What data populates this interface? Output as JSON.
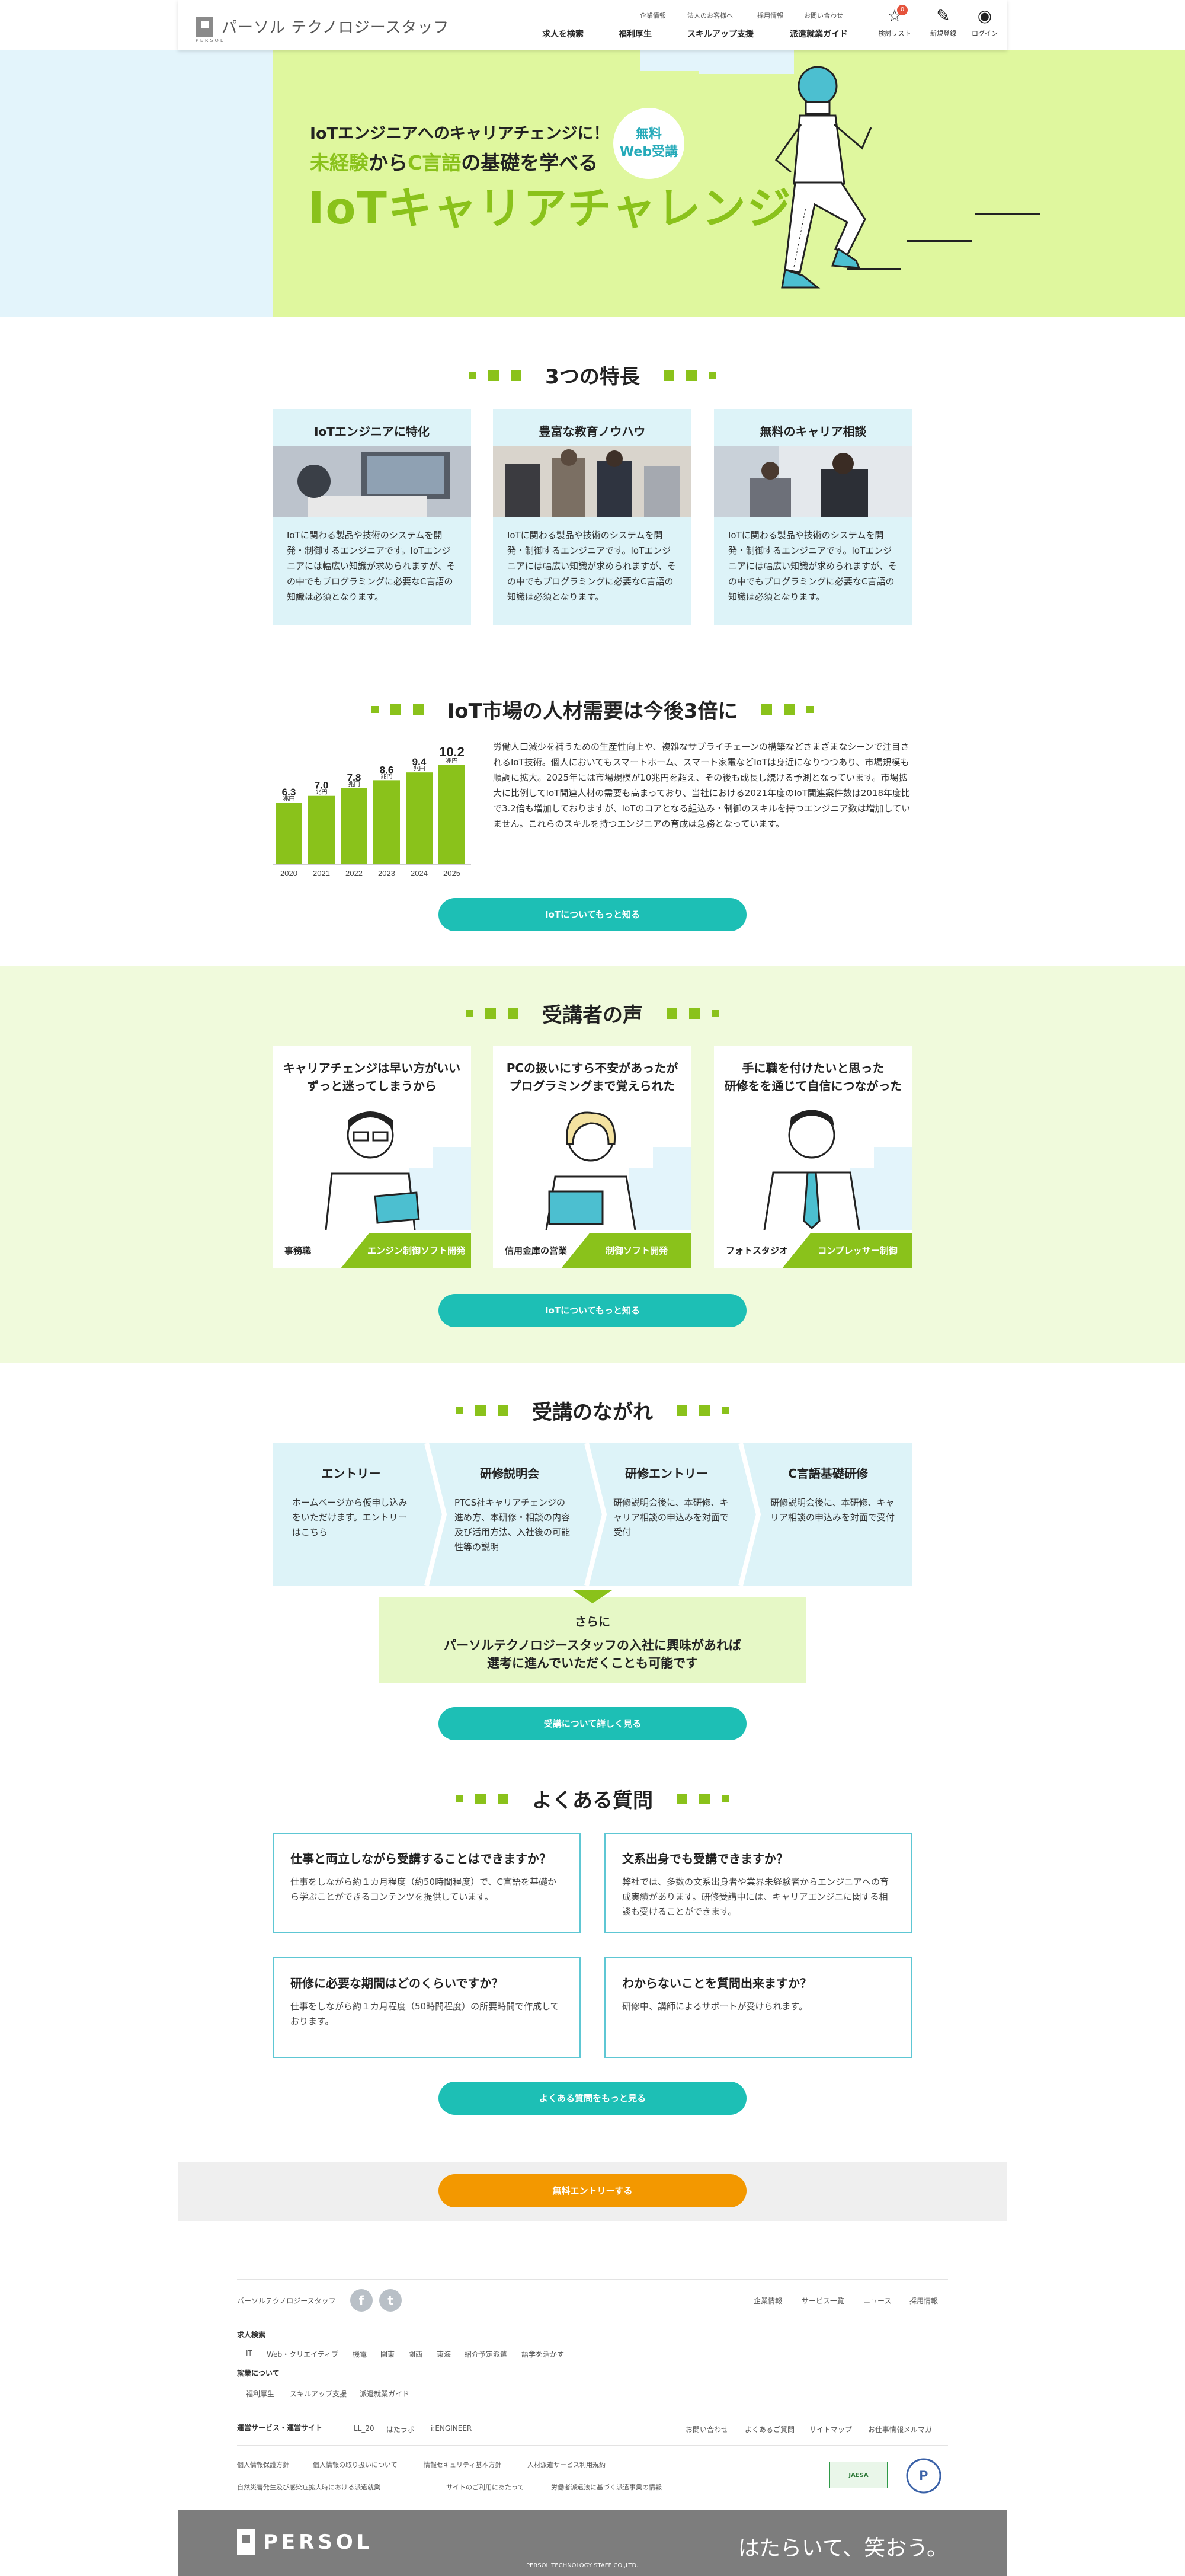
{
  "header": {
    "brand": "パーソル テクノロジースタッフ",
    "brand_sub": "PERSOL",
    "utility": [
      "企業情報",
      "法人のお客様へ",
      "採用情報",
      "お問い合わせ"
    ],
    "nav": [
      "求人を検索",
      "福利厚生",
      "スキルアップ支援",
      "派遣就業ガイド"
    ],
    "icons": [
      {
        "label": "検討リスト",
        "icon": "star-icon",
        "badge": "0"
      },
      {
        "label": "新規登録",
        "icon": "edit-icon"
      },
      {
        "label": "ログイン",
        "icon": "user-icon"
      }
    ]
  },
  "hero": {
    "pre": "IoTエンジニアへのキャリアチェンジに！",
    "sub_a": "未経験",
    "sub_b": "から",
    "sub_c": "C言語",
    "sub_d": "の基礎を学べる",
    "title": "IoTキャリアチャレンジ",
    "badge_1": "無料",
    "badge_2": "Web受講"
  },
  "features": {
    "heading": "3つの特長",
    "items": [
      {
        "title": "IoTエンジニアに特化",
        "text": "IoTに関わる製品や技術のシステムを開発・制御するエンジニアです。IoTエンジニアには幅広い知識が求められますが、その中でもプログラミングに必要なC言語の知識は必須となります。"
      },
      {
        "title": "豊富な教育ノウハウ",
        "text": "IoTに関わる製品や技術のシステムを開発・制御するエンジニアです。IoTエンジニアには幅広い知識が求められますが、その中でもプログラミングに必要なC言語の知識は必須となります。"
      },
      {
        "title": "無料のキャリア相談",
        "text": "IoTに関わる製品や技術のシステムを開発・制御するエンジニアです。IoTエンジニアには幅広い知識が求められますが、その中でもプログラミングに必要なC言語の知識は必須となります。"
      }
    ]
  },
  "market": {
    "heading": "IoT市場の人材需要は今後3倍に",
    "text": "労働人口減少を補うための生産性向上や、複雑なサプライチェーンの構築などさまざまなシーンで注目されるIoT技術。個人においてもスマートホーム、スマート家電などIoTは身近になりつつあり、市場規模も順調に拡大。2025年には市場規模が10兆円を超え、その後も成長し続ける予測となっています。市場拡大に比例してIoT関連人材の需要も高まっており、当社における2021年度のIoT関連案件数は2018年度比で3.2倍も増加しておりますが、IoTのコアとなる組込み・制御のスキルを持つエンジニア数は増加していません。これらのスキルを持つエンジニアの育成は急務となっています。",
    "button": "IoTについてもっと知る"
  },
  "chart_data": {
    "type": "bar",
    "categories": [
      "2020",
      "2021",
      "2022",
      "2023",
      "2024",
      "2025"
    ],
    "values": [
      6.3,
      7.0,
      7.8,
      8.6,
      9.4,
      10.2
    ],
    "unit": "兆円",
    "value_labels": [
      "6.3",
      "7.0",
      "7.8",
      "8.6",
      "9.4",
      "10.2"
    ],
    "color": "#8ac21b",
    "ylim": [
      0,
      10.2
    ]
  },
  "voices": {
    "heading": "受講者の声",
    "items": [
      {
        "title_1": "キャリアチェンジは早い方がいい",
        "title_2": "ずっと迷ってしまうから",
        "from": "事務職",
        "to": "エンジン制御ソフト開発"
      },
      {
        "title_1": "PCの扱いにすら不安があったが",
        "title_2": "プログラミングまで覚えられた",
        "from": "信用金庫の営業",
        "to": "制御ソフト開発"
      },
      {
        "title_1": "手に職を付けたいと思った",
        "title_2": "研修をを通じて自信につながった",
        "from": "フォトスタジオ",
        "to": "コンプレッサー制御"
      }
    ],
    "button": "IoTについてもっと知る"
  },
  "flow": {
    "heading": "受講のながれ",
    "steps": [
      {
        "title": "エントリー",
        "text": "ホームページから仮申し込みをいただけます。エントリーはこちら"
      },
      {
        "title": "研修説明会",
        "text": "PTCS社キャリアチェンジの進め方、本研修・相談の内容及び活用方法、入社後の可能性等の説明"
      },
      {
        "title": "研修エントリー",
        "text": "研修説明会後に、本研修、キャリア相談の申込みを対面で受付"
      },
      {
        "title": "C言語基礎研修",
        "text": "研修説明会後に、本研修、キャリア相談の申込みを対面で受付"
      }
    ],
    "further_a": "さらに",
    "further_b": "パーソルテクノロジースタッフの入社に興味があれば",
    "further_c": "選考に進んでいただくことも可能です",
    "button": "受講について詳しく見る"
  },
  "faq": {
    "heading": "よくある質問",
    "items": [
      {
        "q": "仕事と両立しながら受講することはできますか？",
        "a": "仕事をしながら約１カ月程度（約50時間程度）で、C言語を基礎から学ぶことができるコンテンツを提供しています。"
      },
      {
        "q": "文系出身でも受講できますか？",
        "a": "弊社では、多数の文系出身者や業界未経験者からエンジニアへの育成実績があります。研修受講中には、キャリアエンジニに関する相談も受けることができます。"
      },
      {
        "q": "研修に必要な期間はどのくらいですか？",
        "a": "仕事をしながら約１カ月程度（50時間程度）の所要時間で作成しております。"
      },
      {
        "q": "わからないことを質問出来ますか？",
        "a": "研修中、講師によるサポートが受けられます。"
      }
    ],
    "button": "よくある質問をもっと見る"
  },
  "entry_button": "無料エントリーする",
  "footer": {
    "brand": "パーソルテクノロジースタッフ",
    "social": [
      "facebook-icon",
      "twitter-icon"
    ],
    "top_links": [
      "企業情報",
      "サービス一覧",
      "ニュース",
      "採用情報"
    ],
    "jobs_heading": "求人検索",
    "jobs_links": [
      "IT",
      "Web・クリエイティブ",
      "機電",
      "関東",
      "関西",
      "東海",
      "紹介予定派遣",
      "語学を活かす"
    ],
    "work_heading": "就業について",
    "work_links": [
      "福利厚生",
      "スキルアップ支援",
      "派遣就業ガイド"
    ],
    "services_heading": "運営サービス・運営サイト",
    "services_links": [
      "LL_20",
      "はたラボ",
      "i:ENGINEER"
    ],
    "right_links": [
      "お問い合わせ",
      "よくあるご質問",
      "サイトマップ",
      "お仕事情報メルマガ"
    ],
    "policy_links_1": [
      "個人情報保護方針",
      "個人情報の取り扱いについて",
      "情報セキュリティ基本方針",
      "人材派遣サービス利用規約"
    ],
    "policy_links_2": [
      "自然災害発生及び感染症拡大時における派遣就業",
      "サイトのご利用にあたって",
      "労働者派遣法に基づく派遣事業の情報"
    ],
    "cert_1": "JAESA",
    "cert_2": "Pマーク",
    "persol": "PERSOL",
    "copyright": "PERSOL TECHNOLOGY STAFF CO.,LTD.",
    "tagline": "はたらいて、笑おう。"
  }
}
